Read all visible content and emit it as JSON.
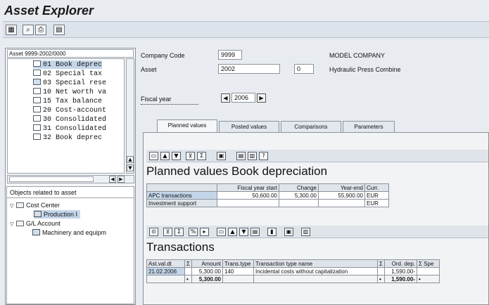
{
  "app": {
    "title": "Asset Explorer"
  },
  "toolbar": {
    "icons": [
      "display-icon",
      "binoculars-icon",
      "print-icon",
      "layout-icon"
    ]
  },
  "nav": {
    "asset_header": "Asset 9999-2002/0000",
    "tree_items": [
      "01 Book deprec",
      "02 Special tax",
      "03 Special rese",
      "10 Net worth va",
      "15 Tax balance",
      "20 Cost-account",
      "30 Consolidated",
      "31 Consolidated",
      "32 Book deprec"
    ],
    "objects_title": "Objects related to asset",
    "objects": {
      "cost_center": "Cost Center",
      "production": "Production I",
      "gl_account": "G/L Account",
      "machinery": "Machinery and equipm"
    }
  },
  "header": {
    "company_code_label": "Company Code",
    "company_code": "9999",
    "company_name": "MODEL COMPANY",
    "asset_label": "Asset",
    "asset_number": "2002",
    "sub_number": "0",
    "asset_description": "Hydraulic Press Combine",
    "fiscal_year_label": "Fiscal year",
    "fiscal_year": "2006"
  },
  "tabs": [
    "Planned values",
    "Posted values",
    "Comparisons",
    "Parameters"
  ],
  "planned": {
    "title": "Planned values Book depreciation",
    "columns": [
      "",
      "Fiscal year start",
      "Change",
      "Year-end",
      "Curr."
    ],
    "rows": [
      {
        "label": "APC transactions",
        "start": "50,600.00",
        "change": "5,300.00",
        "end": "55,900.00",
        "curr": "EUR"
      },
      {
        "label": "Investment support",
        "start": "",
        "change": "",
        "end": "",
        "curr": "EUR"
      }
    ]
  },
  "transactions": {
    "title": "Transactions",
    "columns": [
      "Ast.val.dt",
      "Σ",
      "Amount",
      "Trans.type",
      "Transaction type name",
      "Σ",
      "Ord. dep.",
      "Σ Spe"
    ],
    "rows": [
      {
        "date": "21.02.2006",
        "amount": "5,300.00",
        "type": "140",
        "name": "Incidental costs without capitalization",
        "ord_dep": "1,590.00-"
      }
    ],
    "total": {
      "marker": "•",
      "amount": "5,300.00",
      "ord_dep": "1,590.00-",
      "ord_marker": "•",
      "ord_tail": "•"
    }
  }
}
